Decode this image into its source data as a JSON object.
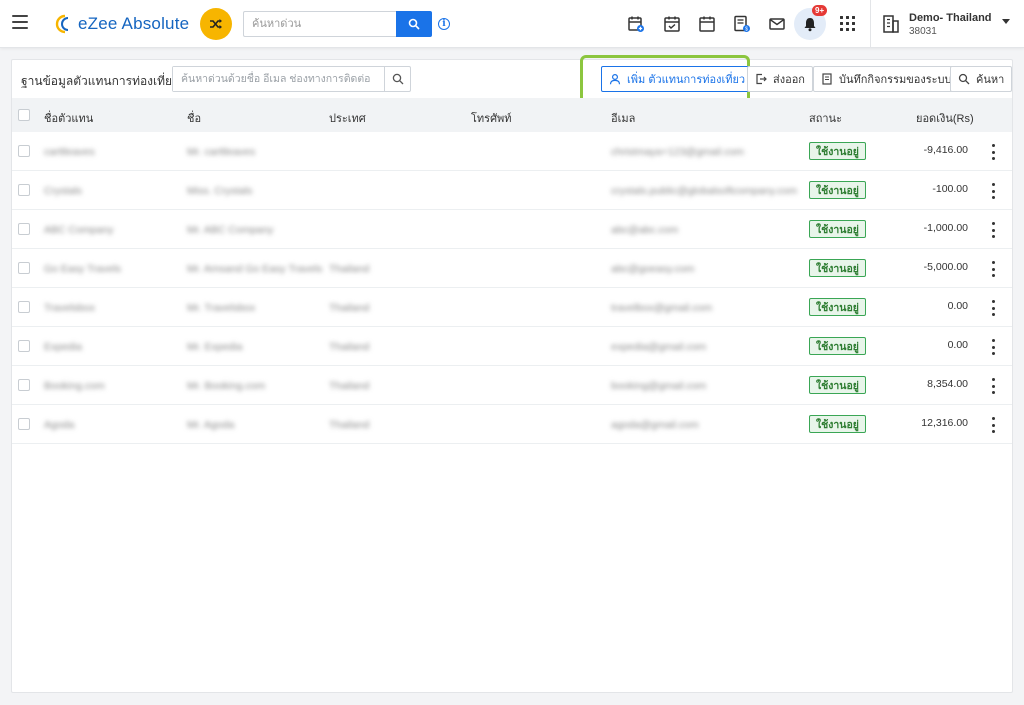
{
  "header": {
    "logo_text": "eZee Absolute",
    "quick_search_placeholder": "ค้นหาด่วน",
    "notification_badge": "9+",
    "property_name": "Demo- Thailand",
    "property_id": "38031",
    "accent_color": "#1a73e8"
  },
  "toolbar": {
    "title": "ฐานข้อมูลตัวแทนการท่องเที่ยว",
    "search_placeholder": "ค้นหาด่วนด้วยชื่อ อีเมล ช่องทางการติดต่อ",
    "add_button_label": "เพิ่ม ตัวแทนการท่องเที่ยว",
    "export_button_label": "ส่งออก",
    "audit_button_label": "บันทึกกิจกรรมของระบบ",
    "search_button_label": "ค้นหา"
  },
  "table": {
    "headers": {
      "agent_name": "ชื่อตัวแทน",
      "name": "ชื่อ",
      "country": "ประเทศ",
      "phone": "โทรศัพท์",
      "email": "อีเมล",
      "status": "สถานะ",
      "balance": "ยอดเงิน(Rs)"
    },
    "rows": [
      {
        "agent": "carttleaves",
        "name": "Mr. carttleaves",
        "country": "",
        "email": "christmaya+123@gmail.com",
        "status": "ใช้งานอยู่",
        "balance": "-9,416.00"
      },
      {
        "agent": "Crystals",
        "name": "Miss. Crystals",
        "country": "",
        "email": "crystals.public@globalsoftcompany.com",
        "status": "ใช้งานอยู่",
        "balance": "-100.00"
      },
      {
        "agent": "ABC Company",
        "name": "Mr. ABC Company",
        "country": "",
        "email": "abc@abc.com",
        "status": "ใช้งานอยู่",
        "balance": "-1,000.00"
      },
      {
        "agent": "Go Easy Travels",
        "name": "Mr. Amsand Go Easy Travels",
        "country": "Thailand",
        "email": "abc@goeasy.com",
        "status": "ใช้งานอยู่",
        "balance": "-5,000.00"
      },
      {
        "agent": "Travelsbox",
        "name": "Mr. Travelsbox",
        "country": "Thailand",
        "email": "travelbox@gmail.com",
        "status": "ใช้งานอยู่",
        "balance": "0.00"
      },
      {
        "agent": "Expedia",
        "name": "Mr. Expedia",
        "country": "Thailand",
        "email": "expedia@gmail.com",
        "status": "ใช้งานอยู่",
        "balance": "0.00"
      },
      {
        "agent": "Booking.com",
        "name": "Mr. Booking.com",
        "country": "Thailand",
        "email": "booking@gmail.com",
        "status": "ใช้งานอยู่",
        "balance": "8,354.00"
      },
      {
        "agent": "Agoda",
        "name": "Mr. Agoda",
        "country": "Thailand",
        "email": "agoda@gmail.com",
        "status": "ใช้งานอยู่",
        "balance": "12,316.00"
      }
    ]
  }
}
